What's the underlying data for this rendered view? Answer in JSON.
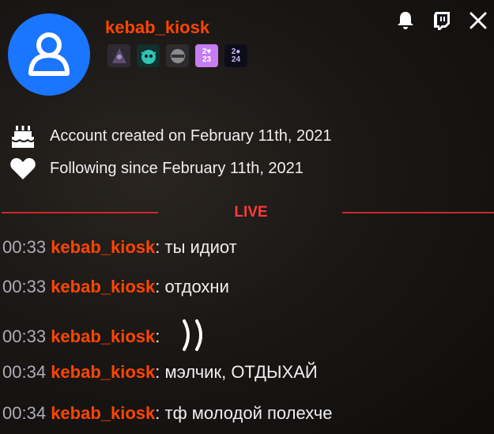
{
  "user": {
    "name": "kebab_kiosk",
    "name_color": "#ff4500",
    "avatar_icon": "default-user-icon",
    "avatar_color": "#1a75ff"
  },
  "badges": [
    {
      "name": "dark-knight-badge",
      "text": ""
    },
    {
      "name": "green-creature-badge",
      "text": ""
    },
    {
      "name": "ninja-badge",
      "text": ""
    },
    {
      "name": "2023-badge",
      "text": "2♥\n23"
    },
    {
      "name": "2024-badge",
      "text": "2●\n24"
    }
  ],
  "actions": [
    "bell-icon",
    "twitch-icon",
    "close-icon"
  ],
  "info": {
    "created": "Account created on February 11th, 2021",
    "following": "Following since February 11th, 2021"
  },
  "live_label": "LIVE",
  "live_color": "#ff3b3b",
  "messages": [
    {
      "time": "00:33",
      "user": "kebab_kiosk",
      "sep": ":",
      "text": " ты идиот"
    },
    {
      "time": "00:33",
      "user": "kebab_kiosk",
      "sep": ":",
      "text": " отдохни"
    },
    {
      "time": "00:33",
      "user": "kebab_kiosk",
      "sep": ":",
      "text": "",
      "emote": "double-parenthesis-emote"
    },
    {
      "time": "00:34",
      "user": "kebab_kiosk",
      "sep": ":",
      "text": " мэлчик, ОТДЫХАЙ"
    },
    {
      "time": "00:34",
      "user": "kebab_kiosk",
      "sep": ":",
      "text": " тф молодой полехче"
    }
  ]
}
